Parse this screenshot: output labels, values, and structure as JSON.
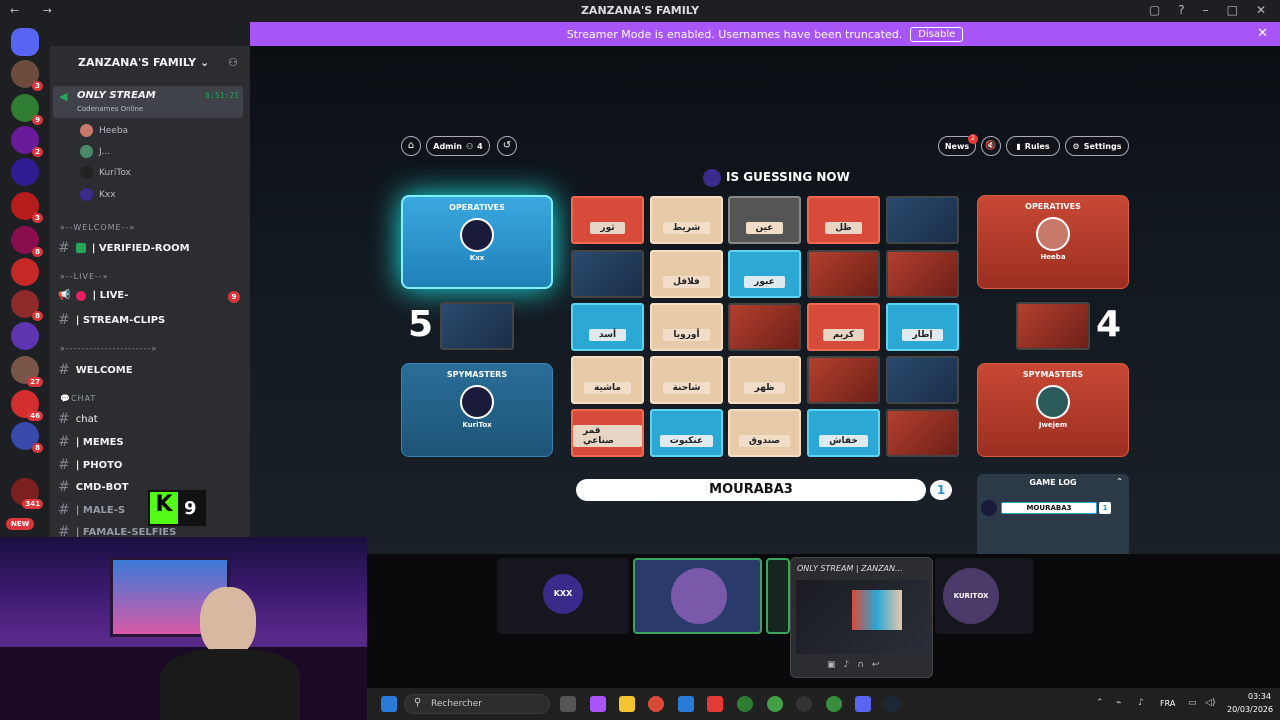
{
  "window": {
    "title": "ZANZANA'S FAMILY",
    "nav": "← →"
  },
  "banner": {
    "text": "Streamer Mode is enabled. Usernames have been truncated.",
    "button": "Disable"
  },
  "servers": {
    "badges": [
      "3",
      "9",
      "2",
      "",
      "3",
      "8",
      "",
      "8",
      "",
      "27",
      "46",
      "8",
      "341"
    ],
    "new_label": "NEW"
  },
  "sidebar": {
    "server_name": "ZANZANA'S FAMILY",
    "voice": {
      "name": "ONLY STREAM",
      "time": "6:51:21",
      "activity": "Codenames Online"
    },
    "users": [
      "Heeba",
      "J...",
      "KuriTox",
      "Kxx"
    ],
    "categories": {
      "welcome": "WELCOME",
      "live": "LIVE",
      "divider": "",
      "chat": "CHAT"
    },
    "channels": {
      "verified": "| VERIFIED-ROOM",
      "live": "| LIVE-",
      "live_badge": "9",
      "stream_clips": "| STREAM-CLIPS",
      "welcome": "WELCOME",
      "chat": "chat",
      "memes": "| MEMES",
      "photo": "| PHOTO",
      "cmd_bot": "CMD-BOT",
      "male": "| MALE-S",
      "female": "| FAMALE-SELFIES"
    },
    "kick_count": "9"
  },
  "game": {
    "buttons": {
      "admin": "Admin",
      "admin_count": "4",
      "news": "News",
      "news_badge": "2",
      "rules": "Rules",
      "settings": "Settings"
    },
    "guessing": "IS GUESSING NOW",
    "blue": {
      "operatives_label": "OPERATIVES",
      "operative": "Kxx",
      "spymasters_label": "SPYMASTERS",
      "spymaster": "KuriTox",
      "score": "5"
    },
    "red": {
      "operatives_label": "OPERATIVES",
      "operative": "Heeba",
      "spymasters_label": "SPYMASTERS",
      "spymaster": "Jwejem",
      "score": "4"
    },
    "cards": [
      {
        "w": "ثور",
        "t": "red"
      },
      {
        "w": "شريط",
        "t": "neu"
      },
      {
        "w": "عين",
        "t": "blk"
      },
      {
        "w": "ظل",
        "t": "red"
      },
      {
        "w": "",
        "t": "img-b"
      },
      {
        "w": "",
        "t": "img-b"
      },
      {
        "w": "فلافل",
        "t": "neu"
      },
      {
        "w": "عبور",
        "t": "blu"
      },
      {
        "w": "",
        "t": "img-r"
      },
      {
        "w": "",
        "t": "img-r"
      },
      {
        "w": "أسد",
        "t": "blu"
      },
      {
        "w": "أوروبا",
        "t": "neu"
      },
      {
        "w": "",
        "t": "img-r"
      },
      {
        "w": "كريم",
        "t": "red"
      },
      {
        "w": "إطار",
        "t": "blu"
      },
      {
        "w": "ماشية",
        "t": "neu"
      },
      {
        "w": "شاحنة",
        "t": "neu"
      },
      {
        "w": "ظهر",
        "t": "neu"
      },
      {
        "w": "",
        "t": "img-r"
      },
      {
        "w": "",
        "t": "img-b"
      },
      {
        "w": "قمر صناعي",
        "t": "red"
      },
      {
        "w": "عنكبوت",
        "t": "blu"
      },
      {
        "w": "صندوق",
        "t": "neu"
      },
      {
        "w": "خفاش",
        "t": "blu"
      },
      {
        "w": "",
        "t": "img-r"
      }
    ],
    "clue": "MOURABA3",
    "clue_count": "1",
    "game_log": {
      "title": "GAME LOG",
      "entry": "MOURABA3",
      "entry_count": "1"
    }
  },
  "stage": {
    "tile1": "KXX",
    "tile3": "KURITOX"
  },
  "popup": {
    "title": "ONLY STREAM | ZANZAN..."
  },
  "taskbar": {
    "search": "Rechercher",
    "lang": "FRA",
    "time": "03:34",
    "date": "20/03/2026"
  }
}
